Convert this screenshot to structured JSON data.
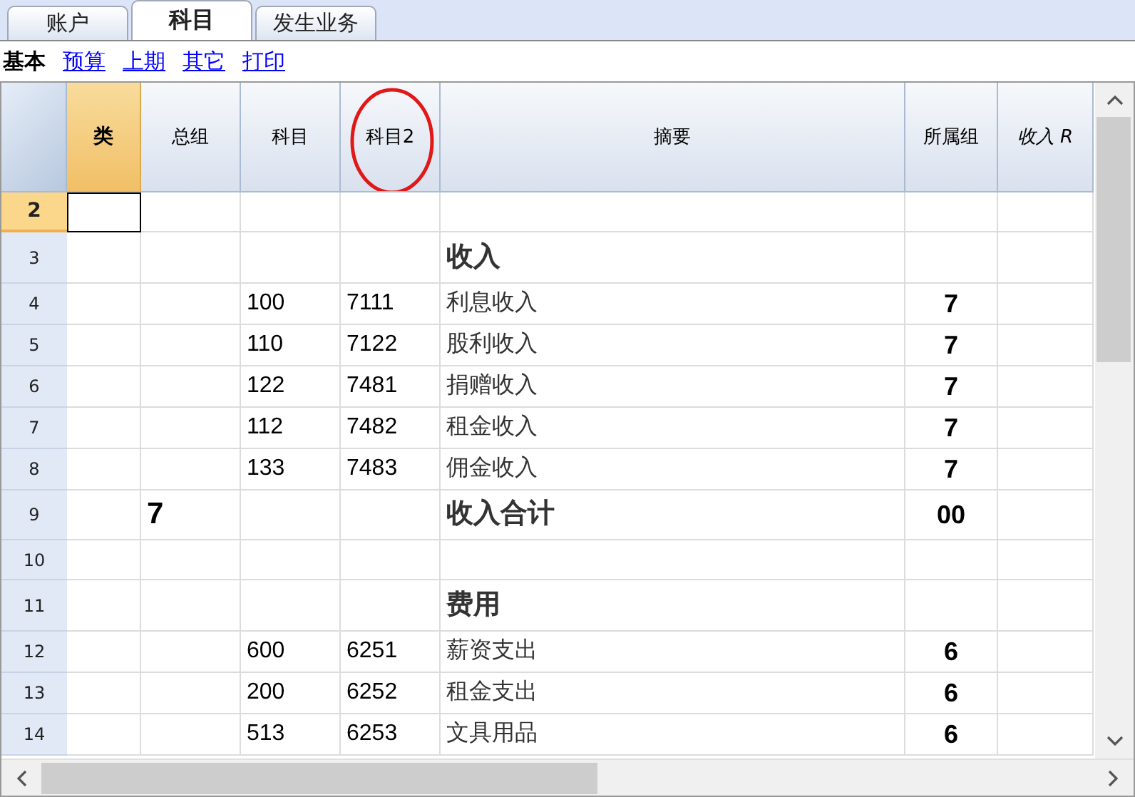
{
  "tabs": [
    {
      "label": "账户",
      "selected": false
    },
    {
      "label": "科目",
      "selected": true
    },
    {
      "label": "发生业务",
      "selected": false
    }
  ],
  "views": [
    {
      "label": "基本",
      "selected": true
    },
    {
      "label": "预算",
      "selected": false
    },
    {
      "label": "上期",
      "selected": false
    },
    {
      "label": "其它",
      "selected": false
    },
    {
      "label": "打印",
      "selected": false
    }
  ],
  "columns": [
    {
      "label": "类",
      "selected": true,
      "circled": false
    },
    {
      "label": "总组",
      "selected": false,
      "circled": false
    },
    {
      "label": "科目",
      "selected": false,
      "circled": false
    },
    {
      "label": "科目2",
      "selected": false,
      "circled": true
    },
    {
      "label": "摘要",
      "selected": false,
      "circled": false
    },
    {
      "label": "所属组",
      "selected": false,
      "circled": false
    },
    {
      "label": "收入 R",
      "selected": false,
      "circled": false
    }
  ],
  "rows": [
    {
      "number": "2",
      "kind": "blank",
      "selected": true
    },
    {
      "number": "3",
      "kind": "heading",
      "description": "收入",
      "selected": false
    },
    {
      "number": "4",
      "kind": "item",
      "account": "100",
      "account2": "7111",
      "description": "利息收入",
      "belongs": "7",
      "selected": false
    },
    {
      "number": "5",
      "kind": "item",
      "account": "110",
      "account2": "7122",
      "description": "股利收入",
      "belongs": "7",
      "selected": false
    },
    {
      "number": "6",
      "kind": "item",
      "account": "122",
      "account2": "7481",
      "description": "捐赠收入",
      "belongs": "7",
      "selected": false
    },
    {
      "number": "7",
      "kind": "item",
      "account": "112",
      "account2": "7482",
      "description": "租金收入",
      "belongs": "7",
      "selected": false
    },
    {
      "number": "8",
      "kind": "item",
      "account": "133",
      "account2": "7483",
      "description": "佣金收入",
      "belongs": "7",
      "selected": false
    },
    {
      "number": "9",
      "kind": "total",
      "group": "7",
      "description": "收入合计",
      "belongs": "00",
      "selected": false
    },
    {
      "number": "10",
      "kind": "blank",
      "selected": false
    },
    {
      "number": "11",
      "kind": "heading",
      "description": "费用",
      "selected": false
    },
    {
      "number": "12",
      "kind": "item",
      "account": "600",
      "account2": "6251",
      "description": "薪资支出",
      "belongs": "6",
      "selected": false
    },
    {
      "number": "13",
      "kind": "item",
      "account": "200",
      "account2": "6252",
      "description": "租金支出",
      "belongs": "6",
      "selected": false
    },
    {
      "number": "14",
      "kind": "item",
      "account": "513",
      "account2": "6253",
      "description": "文具用品",
      "belongs": "6",
      "selected": false
    }
  ]
}
